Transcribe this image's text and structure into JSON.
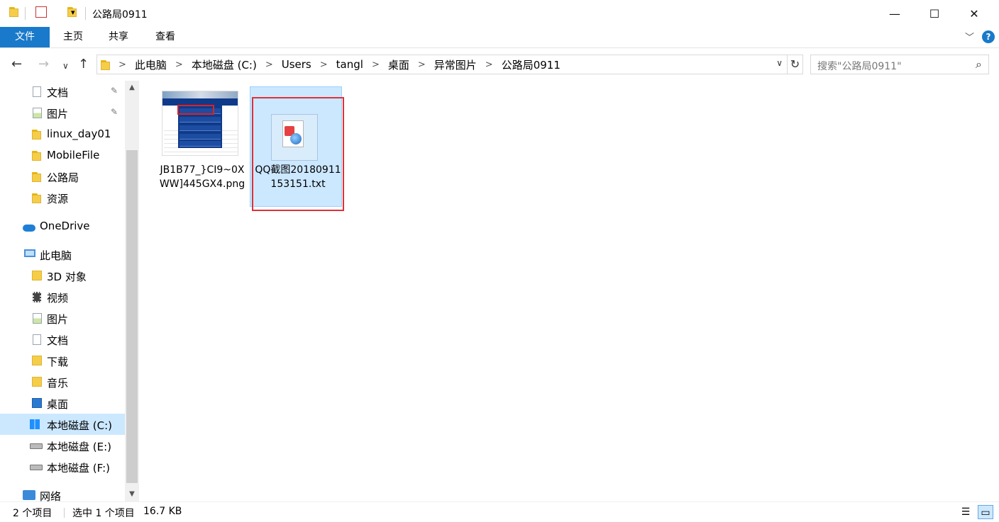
{
  "window": {
    "title": "公路局0911",
    "minimize": "—",
    "maximize": "☐",
    "close": "✕"
  },
  "ribbon": {
    "tabs": [
      "文件",
      "主页",
      "共享",
      "查看"
    ],
    "expand": "﹀",
    "help": "?"
  },
  "nav": {
    "back": "←",
    "forward": "→",
    "recent": "∨",
    "up": "↑"
  },
  "address": {
    "crumbs": [
      "此电脑",
      "本地磁盘 (C:)",
      "Users",
      "tangl",
      "桌面",
      "异常图片",
      "公路局0911"
    ],
    "separator": ">",
    "dropdown": "∨",
    "refresh": "↻"
  },
  "search": {
    "placeholder": "搜索\"公路局0911\"",
    "icon": "search-icon"
  },
  "sidebar": {
    "items": [
      {
        "label": "文档",
        "icon": "documents-icon",
        "pinned": true
      },
      {
        "label": "图片",
        "icon": "pictures-icon",
        "pinned": true
      },
      {
        "label": "linux_day01",
        "icon": "folder-icon"
      },
      {
        "label": "MobileFile",
        "icon": "folder-icon"
      },
      {
        "label": "公路局",
        "icon": "folder-icon"
      },
      {
        "label": "资源",
        "icon": "folder-icon"
      },
      {
        "label": "OneDrive",
        "icon": "onedrive-icon"
      },
      {
        "label": "此电脑",
        "icon": "this-pc-icon"
      },
      {
        "label": "3D 对象",
        "icon": "3d-objects-icon"
      },
      {
        "label": "视频",
        "icon": "videos-icon"
      },
      {
        "label": "图片",
        "icon": "pictures-icon"
      },
      {
        "label": "文档",
        "icon": "documents-icon"
      },
      {
        "label": "下载",
        "icon": "downloads-icon"
      },
      {
        "label": "音乐",
        "icon": "music-icon"
      },
      {
        "label": "桌面",
        "icon": "desktop-icon"
      },
      {
        "label": "本地磁盘 (C:)",
        "icon": "windows-drive-icon",
        "active": true
      },
      {
        "label": "本地磁盘 (E:)",
        "icon": "drive-icon"
      },
      {
        "label": "本地磁盘 (F:)",
        "icon": "drive-icon"
      },
      {
        "label": "网络",
        "icon": "network-icon"
      }
    ],
    "pin_glyph": "📌"
  },
  "files": [
    {
      "name": "JB1B77_}CI9~0XWW]445GX4.png",
      "icon": "image-thumbnail",
      "selected": false
    },
    {
      "name": "QQ截图20180911153151.txt",
      "icon": "text-file-icon",
      "selected": true
    }
  ],
  "status": {
    "count": "2 个项目",
    "selection": "选中 1 个项目",
    "size": "16.7 KB"
  },
  "colors": {
    "accent": "#1979ca",
    "selection": "#cce8ff",
    "highlight_box": "#e0303a"
  }
}
